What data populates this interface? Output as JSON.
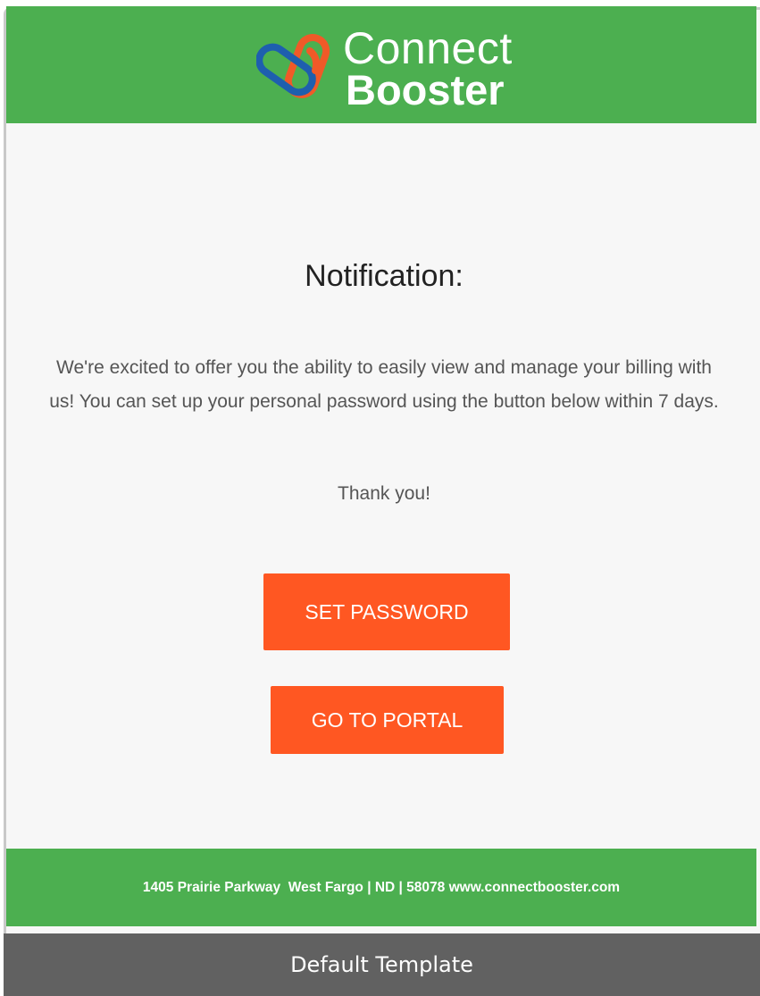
{
  "brand": {
    "word1": "Connect",
    "word2": "Booster",
    "logo_icon": "chain-link-icon",
    "colors": {
      "green": "#4caf50",
      "orange": "#ff5722",
      "blue": "#1e5fae",
      "logo_orange": "#f05a28"
    }
  },
  "email": {
    "title": "Notification:",
    "message": "We're excited to offer you the ability to easily view and manage your billing with us! You can set up your personal password using the button below within 7 days.",
    "thanks": "Thank you!",
    "set_password_label": "SET PASSWORD",
    "go_to_portal_label": "GO TO PORTAL",
    "footer_text": "1405 Prairie Parkway  West Fargo | ND | 58078 www.connectbooster.com"
  },
  "caption": {
    "label": "Default Template"
  }
}
